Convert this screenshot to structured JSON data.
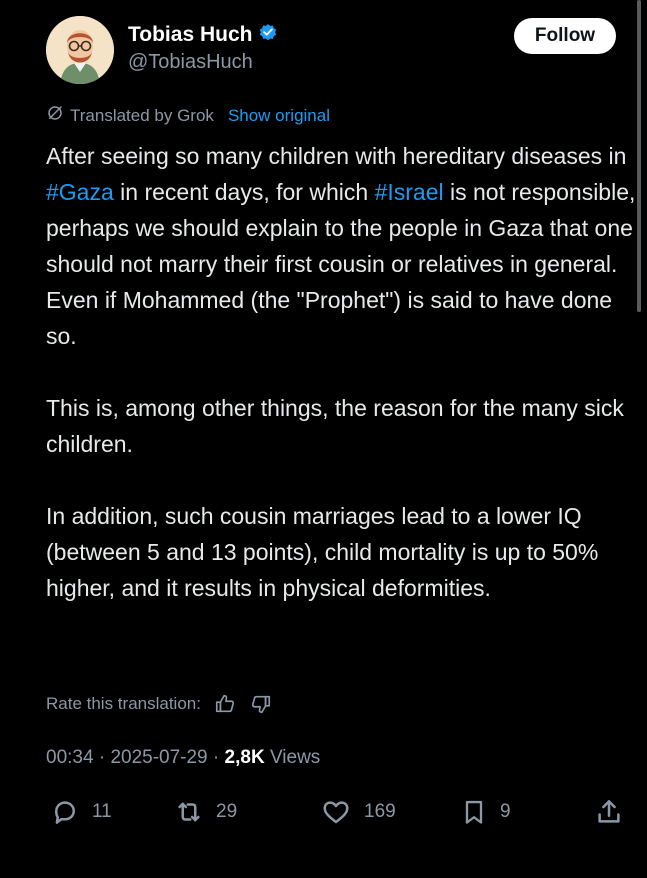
{
  "author": {
    "display_name": "Tobias Huch",
    "handle": "@TobiasHuch",
    "verified": true
  },
  "follow_label": "Follow",
  "translation": {
    "label": "Translated by Grok",
    "show_original": "Show original"
  },
  "tweet": {
    "para1_before_gaza": "After seeing so many children with hereditary diseases in ",
    "hashtag_gaza": "#Gaza",
    "para1_after_gaza": " in recent days, for which ",
    "hashtag_israel": "#Israel",
    "para1_after_israel": " is not responsible, perhaps we should explain to the people in Gaza that one should not marry their first cousin or relatives in general. Even if Mohammed (the \"Prophet\") is said to have done so.",
    "para2": "This is, among other things, the reason for the many sick children.",
    "para3": "In addition, such cousin marriages lead to a lower IQ (between 5 and 13 points), child mortality is up to 50% higher, and it results in physical deformities."
  },
  "rate": {
    "label": "Rate this translation:"
  },
  "meta": {
    "time": "00:34",
    "date": "2025-07-29",
    "views_count": "2,8K",
    "views_label": "Views",
    "separator": "·"
  },
  "actions": {
    "replies": "11",
    "reposts": "29",
    "likes": "169",
    "bookmarks": "9"
  },
  "colors": {
    "background": "#000000",
    "text": "#e7e9ea",
    "secondary": "#8b98a5",
    "link": "#1d9bf0",
    "verified": "#1d9bf0"
  }
}
